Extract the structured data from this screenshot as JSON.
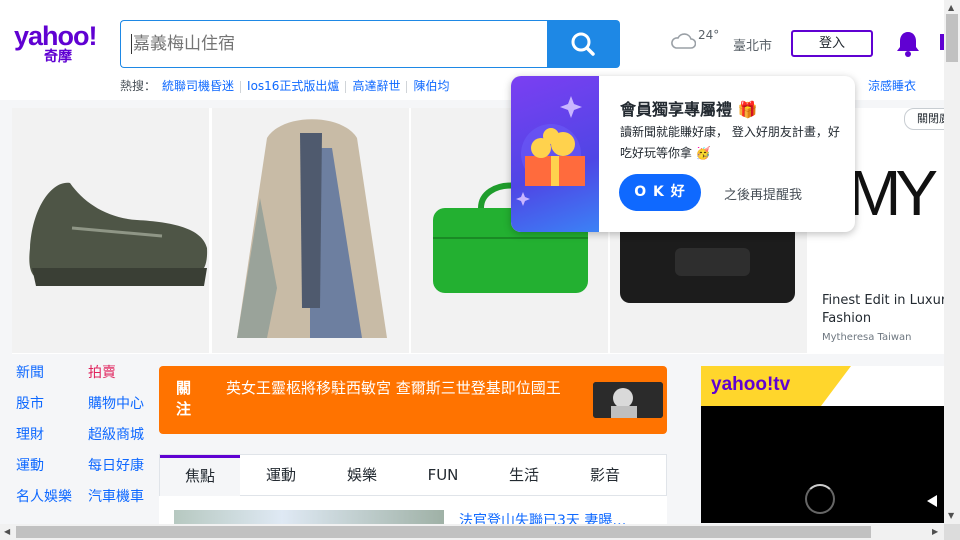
{
  "header": {
    "logo_text": "yahoo!",
    "logo_sub": "奇摩",
    "search_placeholder": "嘉義梅山住宿",
    "temperature": "24°",
    "city": "臺北市",
    "login_label": "登入"
  },
  "trending": {
    "prefix": "熱搜：",
    "items": [
      "統聯司機昏迷",
      "Ios16正式版出爐",
      "高達辭世",
      "陳伯均"
    ],
    "tail": "涼感睡衣"
  },
  "banner": {
    "ad_logo": "MY",
    "ad_tag": "關閉廣",
    "ad_title": "Finest Edit in Luxury Fashion",
    "ad_source": "Mytheresa Taiwan"
  },
  "popup": {
    "title": "會員獨享專屬禮 🎁",
    "body": "讀新聞就能賺好康， 登入好朋友計畫，好吃好玩等你拿 🥳",
    "ok_label": "O K 好",
    "later_label": "之後再提醒我"
  },
  "left_nav": {
    "col1": [
      "新聞",
      "股市",
      "理財",
      "運動",
      "名人娛樂"
    ],
    "col2": [
      "拍賣",
      "購物中心",
      "超級商城",
      "每日好康",
      "汽車機車"
    ]
  },
  "breaking": {
    "label": "關注",
    "text": "英女王靈柩將移駐西敏宮 查爾斯三世登基即位國王"
  },
  "tabs": [
    "焦點",
    "運動",
    "娛樂",
    "FUN",
    "生活",
    "影音"
  ],
  "headline": "法官登山失聯已3天 妻曝…",
  "tv": {
    "logo": "yahoo!tv"
  },
  "colors": {
    "brand": "#6001d2",
    "accent": "#1e88e5",
    "breaking": "#ff7300"
  }
}
